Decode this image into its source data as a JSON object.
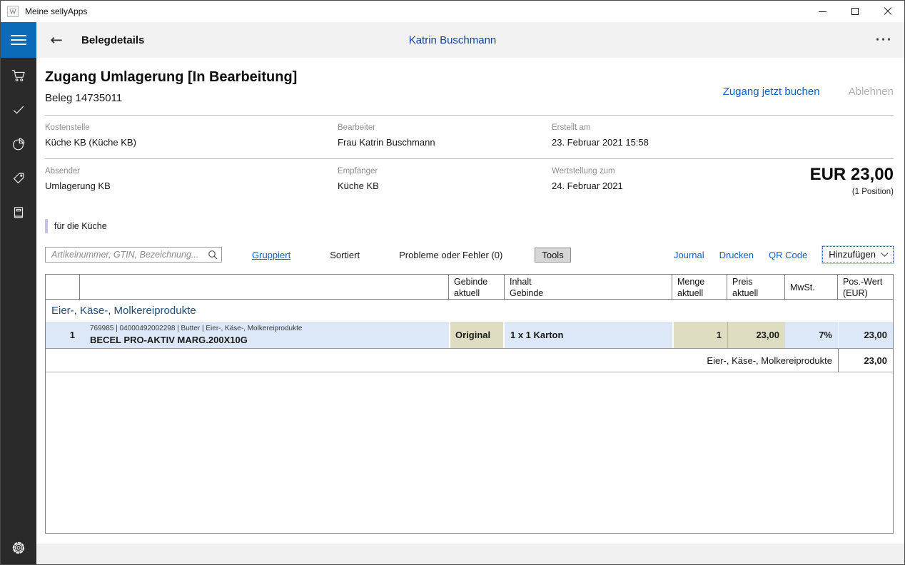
{
  "window": {
    "title": "Meine sellyApps"
  },
  "header": {
    "title": "Belegdetails",
    "user": "Katrin Buschmann",
    "more": "···"
  },
  "sidebar": {
    "icons": [
      "cart-icon",
      "check-icon",
      "pie-chart-icon",
      "tag-icon",
      "book-icon",
      "gear-icon"
    ]
  },
  "document": {
    "title": "Zugang Umlagerung [In Bearbeitung]",
    "beleg": "Beleg 14735011",
    "actions": {
      "book": "Zugang jetzt buchen",
      "reject": "Ablehnen"
    },
    "fields_row1": [
      {
        "label": "Kostenstelle",
        "value": "Küche KB (Küche KB)"
      },
      {
        "label": "Bearbeiter",
        "value": "Frau Katrin Buschmann"
      },
      {
        "label": "Erstellt am",
        "value": "23. Februar 2021 15:58"
      }
    ],
    "fields_row2": [
      {
        "label": "Absender",
        "value": "Umlagerung KB"
      },
      {
        "label": "Empfänger",
        "value": "Küche KB"
      },
      {
        "label": "Wertstellung zum",
        "value": "24. Februar 2021"
      }
    ],
    "total": {
      "amount": "EUR 23,00",
      "positions": "(1 Position)"
    },
    "note": "für die Küche"
  },
  "toolbar": {
    "search_placeholder": "Artikelnummer, GTIN, Bezeichnung...",
    "grouped": "Gruppiert",
    "sorted": "Sortiert",
    "problems": "Probleme oder Fehler (0)",
    "tools": "Tools",
    "journal": "Journal",
    "print": "Drucken",
    "qr": "QR Code",
    "add": "Hinzufügen"
  },
  "table": {
    "headers": [
      {
        "line1": "",
        "line2": ""
      },
      {
        "line1": "",
        "line2": ""
      },
      {
        "line1": "Gebinde",
        "line2": "aktuell"
      },
      {
        "line1": "Inhalt",
        "line2": "Gebinde"
      },
      {
        "line1": "Menge",
        "line2": "aktuell"
      },
      {
        "line1": "Preis",
        "line2": "aktuell"
      },
      {
        "line1": "MwSt.",
        "line2": ""
      },
      {
        "line1": "Pos.-Wert",
        "line2": "(EUR)"
      }
    ],
    "group": "Eier-, Käse-, Molkereiprodukte",
    "row": {
      "index": "1",
      "meta": "769985 | 04000492002298 | Butter | Eier-, Käse-, Molkereiprodukte",
      "name": "BECEL PRO-AKTIV MARG.200X10G",
      "gebinde": "Original",
      "inhalt": "1 x 1 Karton",
      "menge": "1",
      "preis": "23,00",
      "mwst": "7%",
      "wert": "23,00"
    },
    "subtotal": {
      "label": "Eier-, Käse-, Molkereiprodukte",
      "value": "23,00"
    }
  },
  "colors": {
    "accent_blue": "#0d6ab8",
    "link_blue": "#0b61c9",
    "user_blue": "#17418f",
    "group_blue": "#1f4e79",
    "row_blue": "#dce8f8",
    "cell_beige": "#deddc2",
    "note_bar": "#c6c2e8",
    "sidebar_dark": "#2a2a2a",
    "header_gray": "#f2f2f2"
  }
}
